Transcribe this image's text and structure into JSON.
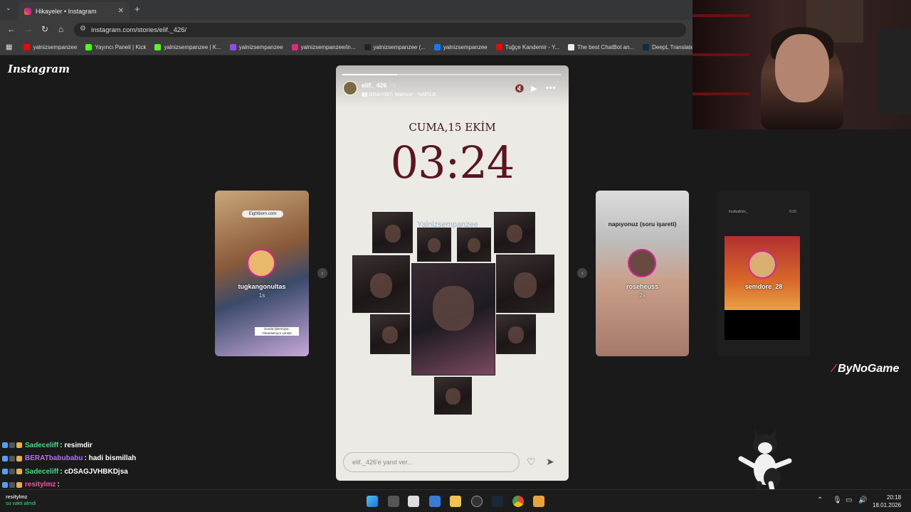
{
  "browser": {
    "tab_title": "Hikayeler • Instagram",
    "url": "instagram.com/stories/elif._426/",
    "bookmarks": [
      {
        "label": "yalnizsempanzee",
        "icon": "youtube-icon",
        "color": "#ff0000"
      },
      {
        "label": "Yayıncı Paneli | Kick",
        "icon": "kick-icon",
        "color": "#53fc18"
      },
      {
        "label": "yalnizsempanzee | K...",
        "icon": "kick-icon",
        "color": "#53fc18"
      },
      {
        "label": "yalnizsempanzee",
        "icon": "twitch-icon",
        "color": "#9146ff"
      },
      {
        "label": "yalnizsempanzee/in...",
        "icon": "instagram-icon",
        "color": "#dd2a7b"
      },
      {
        "label": "yalnizsempanzee (...",
        "icon": "tiktok-icon",
        "color": "#222222"
      },
      {
        "label": "yalnizsempanzee",
        "icon": "facebook-icon",
        "color": "#1877f2"
      },
      {
        "label": "Tuğçe Kandemir - Y...",
        "icon": "youtube-icon",
        "color": "#ff0000"
      },
      {
        "label": "The best ChatBot an...",
        "icon": "chatbot-icon",
        "color": "#eeeeee"
      },
      {
        "label": "DeepL Translate",
        "icon": "deepl-icon",
        "color": "#0f2b46"
      }
    ]
  },
  "instagram": {
    "logo": "Instagram",
    "left_story": {
      "user": "tugkangonultas",
      "time": "1s",
      "tag": "Eightborn.com",
      "sticker": "Sonda İşlenmiyor, Yokanlamıyor çantalı"
    },
    "right_story_1": {
      "header": "napıyonuz (soru işareti)",
      "user": "roseheuss",
      "time": "2s"
    },
    "right_story_2": {
      "user": "semdore_28",
      "time": "",
      "top_user": "footballmix_",
      "top_time": "0:20"
    },
    "main_story": {
      "user": "elif._426",
      "age": "7d",
      "music": "ERAY067, Mansur · NAFİLE",
      "progress": 0.25,
      "date": "CUMA,15 EKİM",
      "clock": "03:24",
      "watermark": "Yalnizsempanzee",
      "reply_placeholder": "elif._426'e yanıt ver..."
    }
  },
  "overlay": {
    "brand": "ByNoGame",
    "chat": [
      {
        "user": "Sadeceliff",
        "color": "#3ddc84",
        "msg": ": resimdir"
      },
      {
        "user": "BERATbabubabu",
        "color": "#b86bff",
        "msg": ": hadi bismillah"
      },
      {
        "user": "Sadeceliff",
        "color": "#3ddc84",
        "msg": ": cDSAGJVHBKDjsa"
      },
      {
        "user": "resitylmz",
        "color": "#ff4fa8",
        "msg": ":"
      }
    ]
  },
  "taskbar": {
    "user_name": "resitylmz",
    "user_status": "su vakti almdi",
    "time": "20:18",
    "date": "18.01.2026"
  }
}
